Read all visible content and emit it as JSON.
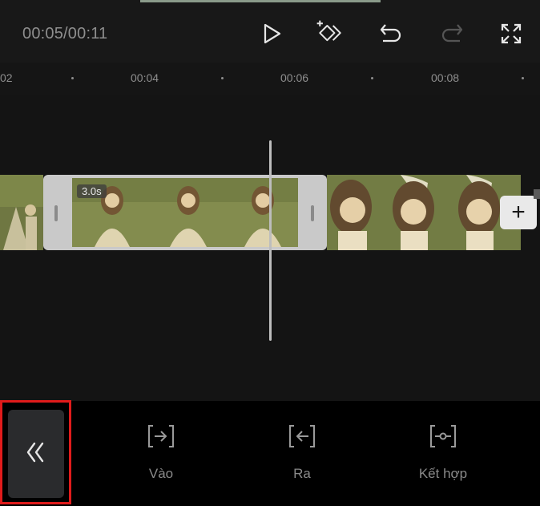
{
  "player": {
    "timecode": "00:05/00:11",
    "controls": [
      "play-icon",
      "add-keyframe-icon",
      "undo-icon",
      "redo-icon",
      "fullscreen-icon"
    ]
  },
  "ruler": {
    "labels": [
      "02",
      "00:04",
      "00:06",
      "00:08"
    ]
  },
  "timeline": {
    "selected_clip_duration": "3.0s",
    "add_clip_symbol": "+"
  },
  "toolbar": {
    "back_icon": "double-chevron-left-icon",
    "items": [
      {
        "label": "Vào",
        "icon": "trim-in-icon"
      },
      {
        "label": "Ra",
        "icon": "trim-out-icon"
      },
      {
        "label": "Kết hợp",
        "icon": "combine-icon"
      }
    ]
  },
  "colors": {
    "background": "#141414",
    "toolbar_background": "#000000",
    "highlight_border": "#e01b1b",
    "selected_clip_handle": "#c9c9c9"
  }
}
